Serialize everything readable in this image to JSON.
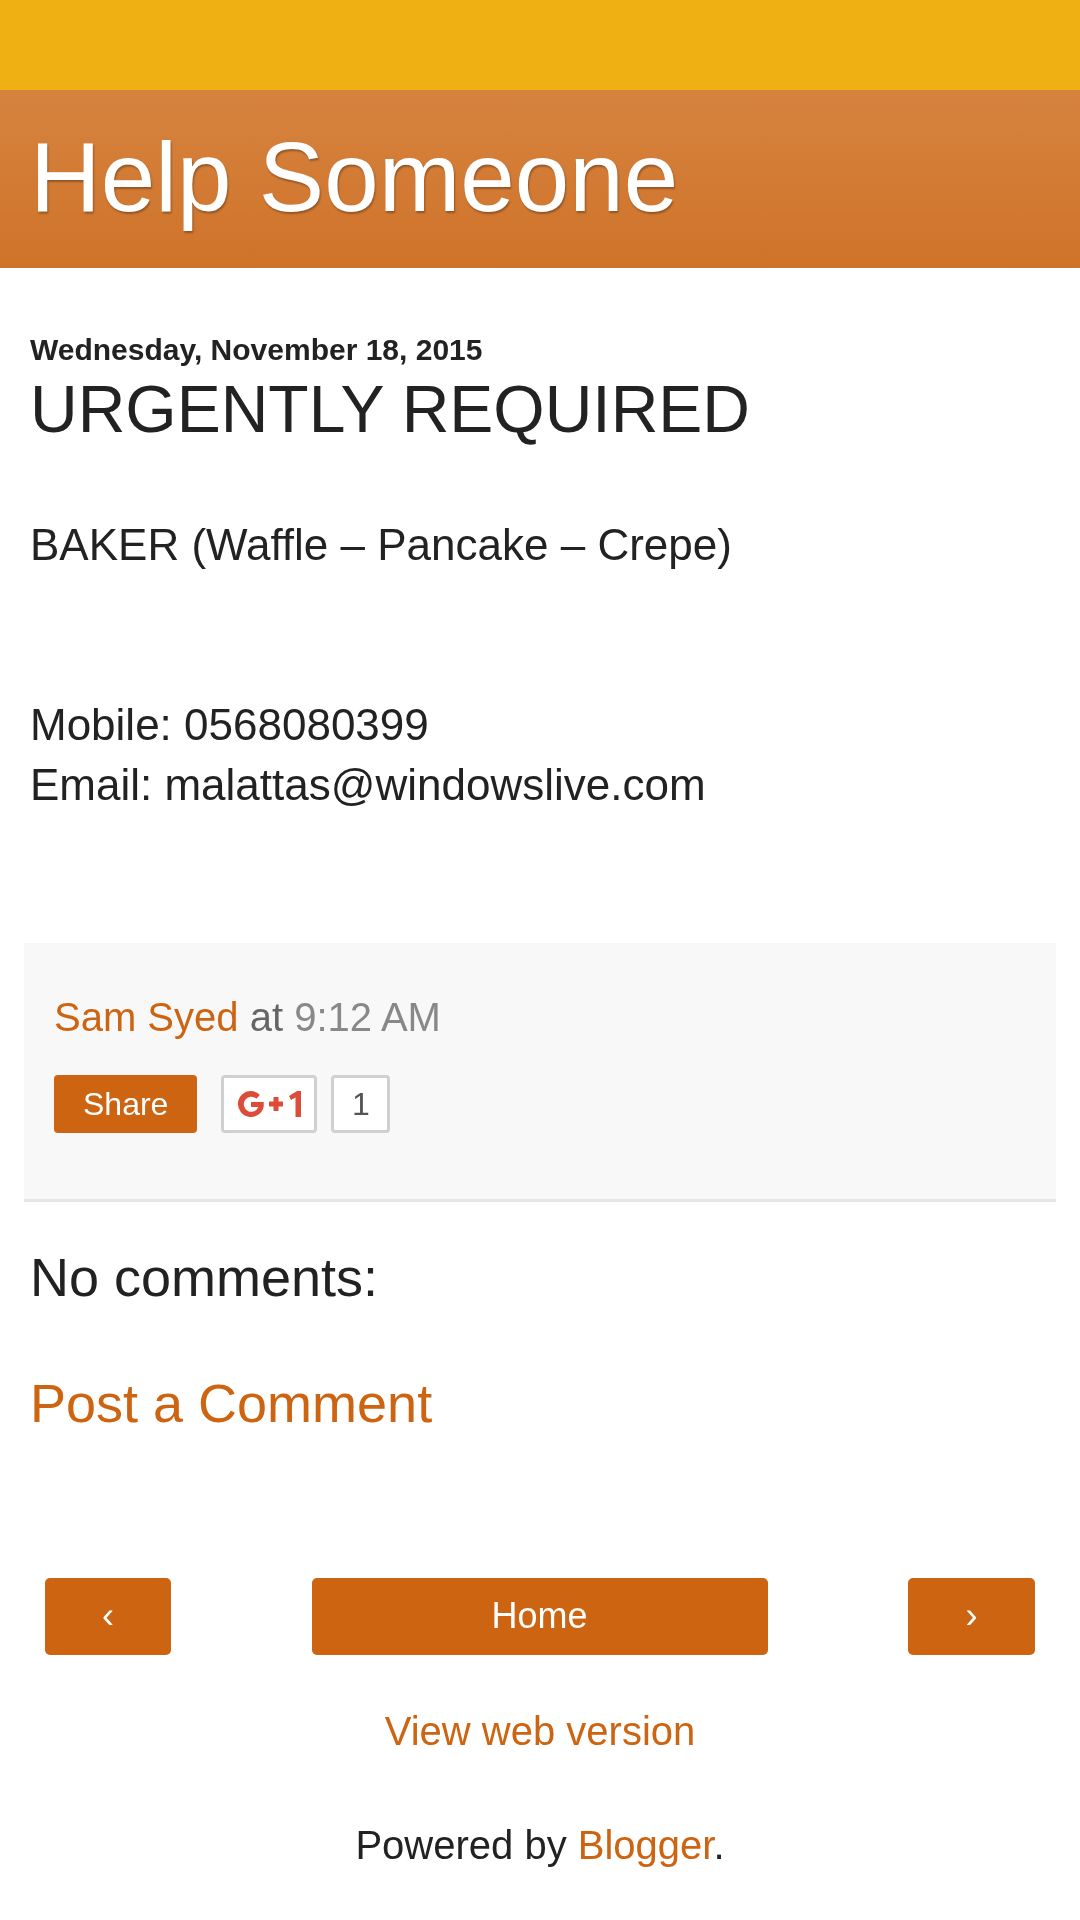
{
  "header": {
    "title": "Help Someone"
  },
  "post": {
    "date": "Wednesday, November 18, 2015",
    "title": "URGENTLY REQUIRED",
    "paragraphs": [
      {
        "lines": [
          "BAKER (Waffle – Pancake – Crepe)"
        ]
      },
      {
        "lines": [
          "Mobile: 0568080399",
          "Email: malattas@windowslive.com"
        ]
      }
    ],
    "footer": {
      "author": "Sam Syed",
      "at": "at",
      "time": "9:12 AM",
      "share_button": "Share",
      "plusone_count": "1"
    }
  },
  "comments": {
    "heading": "No comments:",
    "post_link": "Post a Comment"
  },
  "nav": {
    "prev": "‹",
    "home": "Home",
    "next": "›"
  },
  "web_version": "View web version",
  "powered": {
    "text": "Powered by",
    "link": "Blogger",
    "end": "."
  }
}
